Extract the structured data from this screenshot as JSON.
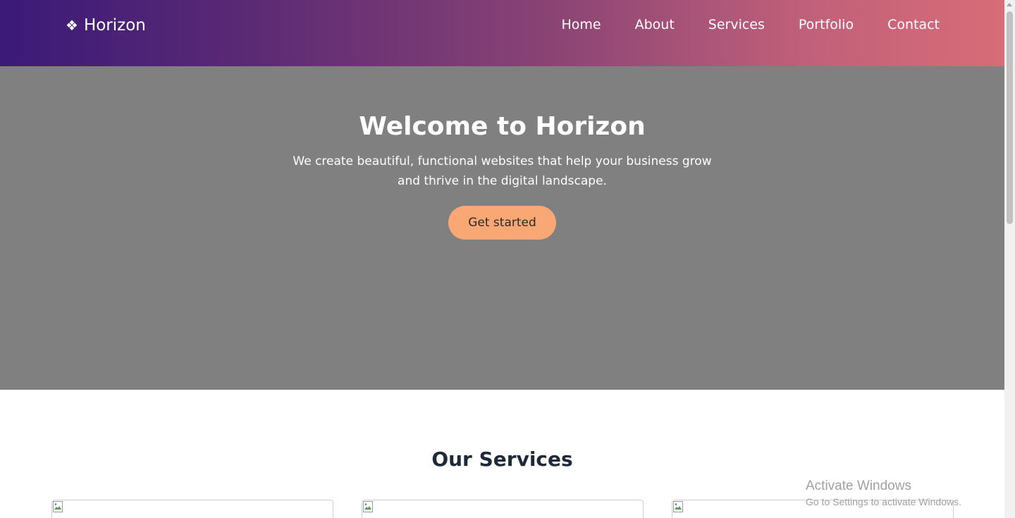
{
  "brand": {
    "name": "Horizon",
    "icon": "diamond-cluster-icon",
    "symbol": "❖"
  },
  "nav": {
    "items": [
      {
        "label": "Home"
      },
      {
        "label": "About"
      },
      {
        "label": "Services"
      },
      {
        "label": "Portfolio"
      },
      {
        "label": "Contact"
      }
    ]
  },
  "hero": {
    "title": "Welcome to Horizon",
    "subtitle": "We create beautiful, functional websites that help your business grow and thrive in the digital landscape.",
    "cta_label": "Get started",
    "background_color": "#808080",
    "cta_color": "#f8a775"
  },
  "services": {
    "title": "Our Services",
    "cards": [
      {
        "image": "broken-image-icon"
      },
      {
        "image": "broken-image-icon"
      },
      {
        "image": "broken-image-icon"
      }
    ]
  },
  "header_gradient": [
    "#3a1a78",
    "#d86c78"
  ],
  "watermark": {
    "title": "Activate Windows",
    "subtitle": "Go to Settings to activate Windows."
  }
}
